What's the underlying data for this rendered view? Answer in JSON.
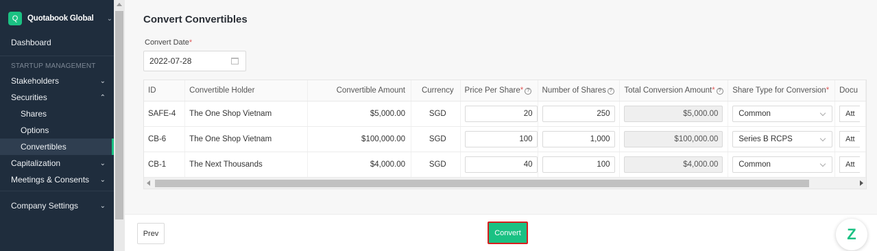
{
  "sidebar": {
    "org": {
      "initial": "Q",
      "name": "Quotabook Global"
    },
    "dashboard": "Dashboard",
    "section_label": "STARTUP MANAGEMENT",
    "items": [
      {
        "label": "Stakeholders"
      },
      {
        "label": "Securities"
      },
      {
        "label": "Shares"
      },
      {
        "label": "Options"
      },
      {
        "label": "Convertibles"
      },
      {
        "label": "Capitalization"
      },
      {
        "label": "Meetings & Consents"
      },
      {
        "label": "Company Settings"
      }
    ]
  },
  "page": {
    "title": "Convert Convertibles",
    "date_label": "Convert Date",
    "date_value": "2022-07-28"
  },
  "table": {
    "headers": {
      "id": "ID",
      "holder": "Convertible Holder",
      "amount": "Convertible Amount",
      "currency": "Currency",
      "pps": "Price Per Share",
      "shares": "Number of Shares",
      "total": "Total Conversion Amount",
      "type": "Share Type for Conversion",
      "doc": "Docu"
    },
    "rows": [
      {
        "id": "SAFE-4",
        "holder": "The One Shop Vietnam",
        "amount": "$5,000.00",
        "currency": "SGD",
        "pps": "20",
        "shares": "250",
        "total": "$5,000.00",
        "type": "Common",
        "doc": "Att"
      },
      {
        "id": "CB-6",
        "holder": "The One Shop Vietnam",
        "amount": "$100,000.00",
        "currency": "SGD",
        "pps": "100",
        "shares": "1,000",
        "total": "$100,000.00",
        "type": "Series B RCPS",
        "doc": "Att"
      },
      {
        "id": "CB-1",
        "holder": "The Next Thousands",
        "amount": "$4,000.00",
        "currency": "SGD",
        "pps": "40",
        "shares": "100",
        "total": "$4,000.00",
        "type": "Common",
        "doc": "Att"
      }
    ]
  },
  "footer": {
    "prev_label": "Prev",
    "convert_label": "Convert"
  },
  "colors": {
    "brand": "#1bc183",
    "sidebar": "#1f2d3d",
    "highlight": "#d81e1e"
  }
}
